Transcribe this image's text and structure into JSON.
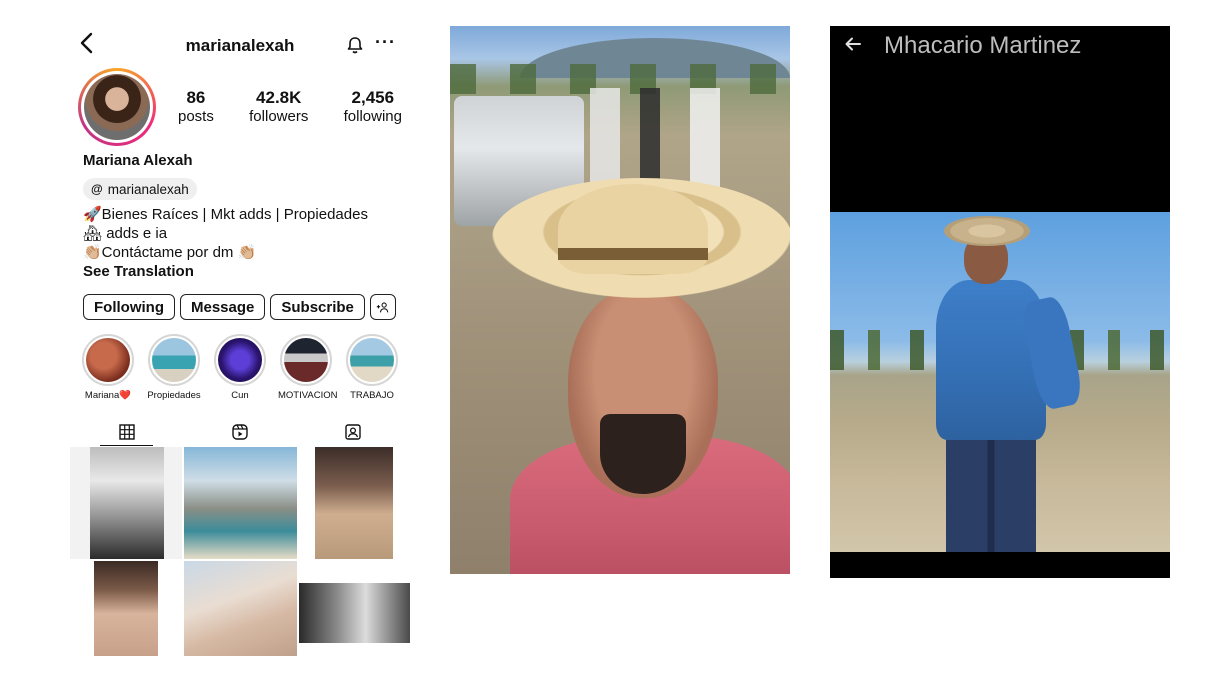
{
  "profile": {
    "handle": "marianalexah",
    "full_name": "Mariana Alexah",
    "threads_handle": "marianalexah",
    "stats": [
      {
        "value": "86",
        "label": "posts"
      },
      {
        "value": "42.8K",
        "label": "followers"
      },
      {
        "value": "2,456",
        "label": "following"
      }
    ],
    "bio": {
      "line1": "🚀Bienes Raíces | Mkt adds | Propiedades",
      "line2": "🏘 adds e ia",
      "line3": "👏🏼Contáctame por dm 👏🏼",
      "see_translation": "See Translation"
    },
    "buttons": {
      "following": "Following",
      "message": "Message",
      "subscribe": "Subscribe",
      "add_person": "+ዾ"
    },
    "highlights": [
      {
        "label": "Mariana❤️"
      },
      {
        "label": "Propiedades"
      },
      {
        "label": "Cun"
      },
      {
        "label": "MOTIVACION"
      },
      {
        "label": "TRABAJO"
      }
    ]
  },
  "panel3": {
    "title": "Mhacario Martinez"
  },
  "icons": {
    "back": "chevron-left-icon",
    "bell": "bell-icon",
    "more": "more-icon",
    "grid": "grid-icon",
    "reels": "reels-icon",
    "tagged": "tagged-icon",
    "arrow_back": "arrow-left-icon"
  },
  "colors": {
    "story_ring": "#ee2a7b",
    "pink_shirt": "#d96b7c",
    "blue_shirt": "#3e7fc9"
  }
}
